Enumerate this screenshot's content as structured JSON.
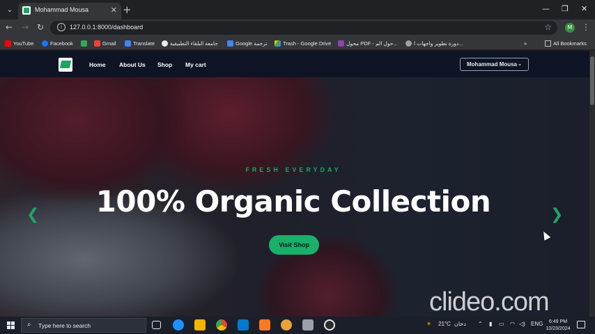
{
  "browser": {
    "tab_title": "Mohammad Mousa",
    "url": "127.0.0.1:8000/dashboard",
    "profile_initial": "M",
    "bookmarks": [
      {
        "label": "YouTube",
        "color": "#ff0000"
      },
      {
        "label": "Facebook",
        "color": "#1877f2"
      },
      {
        "label": "",
        "color": "#34a853"
      },
      {
        "label": "Gmail",
        "color": "#ea4335"
      },
      {
        "label": "Translate",
        "color": "#4285f4"
      },
      {
        "label": "جامعة البلقاء التطبيقية",
        "color": "#e8eaed"
      },
      {
        "label": "Google ترجمة",
        "color": "#4285f4"
      },
      {
        "label": "Trash - Google Drive",
        "color": "#fbbc04"
      },
      {
        "label": "محول PDF - حول الم...",
        "color": "#8e44ad"
      },
      {
        "label": "دورة تطوير واجهات ا...",
        "color": "#9aa0a6"
      }
    ],
    "all_bookmarks": "All Bookmarks"
  },
  "site": {
    "nav": [
      "Home",
      "About Us",
      "Shop",
      "My cart"
    ],
    "user_button": "Mohammad Mousa",
    "hero": {
      "eyebrow": "FRESH EVERYDAY",
      "headline": "100% Organic Collection",
      "cta": "Visit Shop"
    },
    "accent_color": "#1fa463"
  },
  "watermark": "clideo.com",
  "taskbar": {
    "search_placeholder": "Type here to search",
    "weather": "21°C",
    "weather_label": "دخان",
    "language": "ENG",
    "time": "6:49 PM",
    "date": "10/23/2024"
  }
}
